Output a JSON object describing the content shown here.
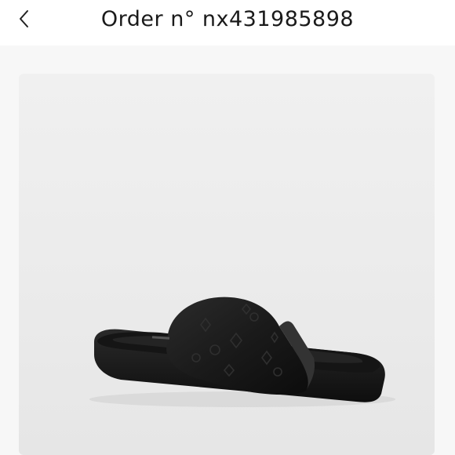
{
  "header": {
    "title": "Order n° nx431985898",
    "back_icon": "chevron-left-icon"
  },
  "product": {
    "image_subject": "black monogram-embossed slide sandal",
    "colors": {
      "sandal": "#1c1c1c",
      "card_background": "#ececec",
      "page_background": "#f7f7f7"
    }
  }
}
